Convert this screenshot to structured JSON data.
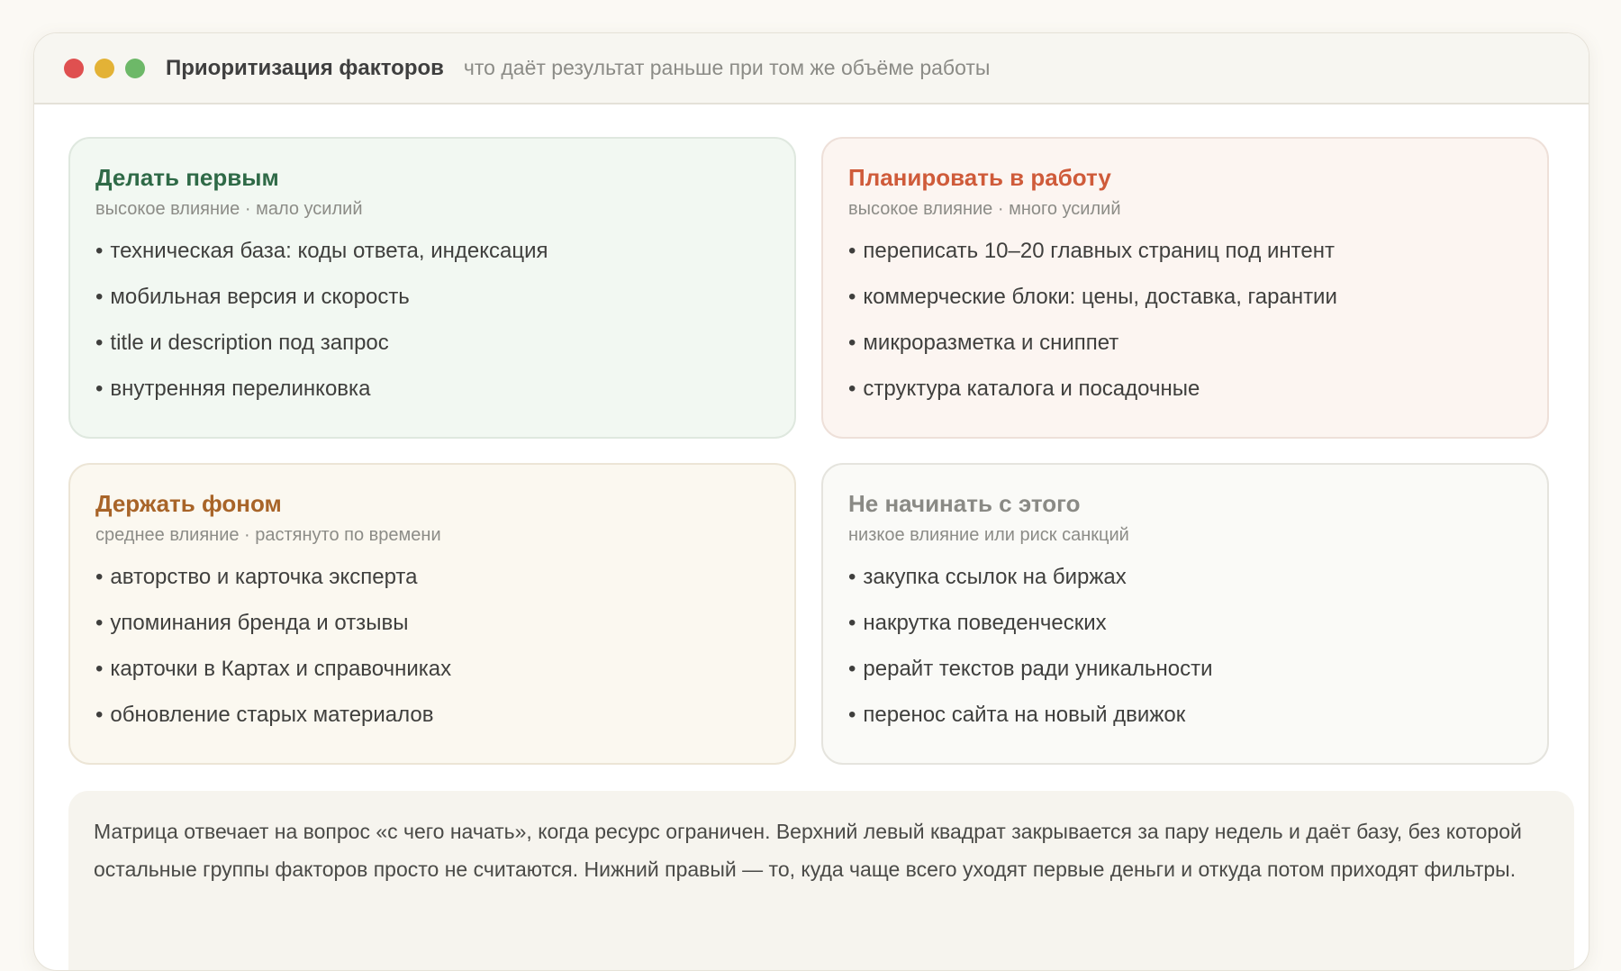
{
  "window": {
    "title": "Приоритизация факторов",
    "subtitle": "что даёт результат раньше при том же объёме работы",
    "controls": {
      "close_color": "#df5050",
      "minimize_color": "#e3b236",
      "maximize_color": "#6db868"
    }
  },
  "quadrants": [
    {
      "title": "Делать первым",
      "subtitle": "высокое влияние · мало усилий",
      "accent": "#2f6a47",
      "items": [
        "техническая база: коды ответа, индексация",
        "мобильная версия и скорость",
        "title и description под запрос",
        "внутренняя перелинковка"
      ]
    },
    {
      "title": "Планировать в работу",
      "subtitle": "высокое влияние · много усилий",
      "accent": "#cf5b3a",
      "items": [
        "переписать 10–20 главных страниц под интент",
        "коммерческие блоки: цены, доставка, гарантии",
        "микроразметка и сниппет",
        "структура каталога и посадочные"
      ]
    },
    {
      "title": "Держать фоном",
      "subtitle": "среднее влияние · растянуто по времени",
      "accent": "#a86428",
      "items": [
        "авторство и карточка эксперта",
        "упоминания бренда и отзывы",
        "карточки в Картах и справочниках",
        "обновление старых материалов"
      ]
    },
    {
      "title": "Не начинать с этого",
      "subtitle": "низкое влияние или риск санкций",
      "accent": "#8a8a85",
      "items": [
        "закупка ссылок на биржах",
        "накрутка поведенческих",
        "рерайт текстов ради уникальности",
        "перенос сайта на новый движок"
      ]
    }
  ],
  "bullet": "•",
  "note": "Матрица отвечает на вопрос «с чего начать», когда ресурс ограничен. Верхний левый квадрат закрывается за пару недель и даёт базу, без которой остальные группы факторов просто не считаются. Нижний правый — то, куда чаще всего уходят первые деньги и откуда потом приходят фильтры."
}
